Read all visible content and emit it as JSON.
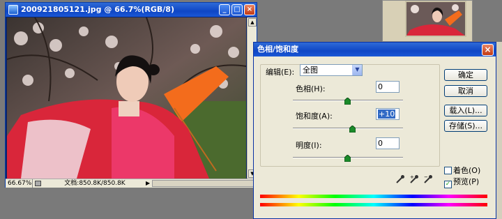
{
  "image_window": {
    "title": "200921805121.jpg @ 66.7%(RGB/8)",
    "minimize_glyph": "_",
    "maximize_glyph": "□",
    "close_glyph": "×",
    "status_zoom": "66.67%",
    "status_doc": "文档:850.8K/850.8K",
    "status_arrow": "▶"
  },
  "dialog": {
    "title": "色相/饱和度",
    "close_glyph": "×",
    "edit_label": "编辑(E):",
    "edit_value": "全图",
    "hue_label": "色相(H):",
    "hue_value": "0",
    "saturation_label": "饱和度(A):",
    "saturation_value": "+10",
    "lightness_label": "明度(I):",
    "lightness_value": "0",
    "buttons": {
      "ok": "确定",
      "cancel": "取消",
      "load": "载入(L)...",
      "save": "存储(S)..."
    },
    "colorize_label": "着色(O)",
    "colorize_checked": false,
    "preview_label": "预览(P)",
    "preview_checked": true,
    "check_glyph": "✓"
  },
  "colors": {
    "titlebar_blue": "#0f46c5",
    "dialog_bg": "#ece9d8",
    "slider_thumb_green": "#1b8a2a"
  }
}
